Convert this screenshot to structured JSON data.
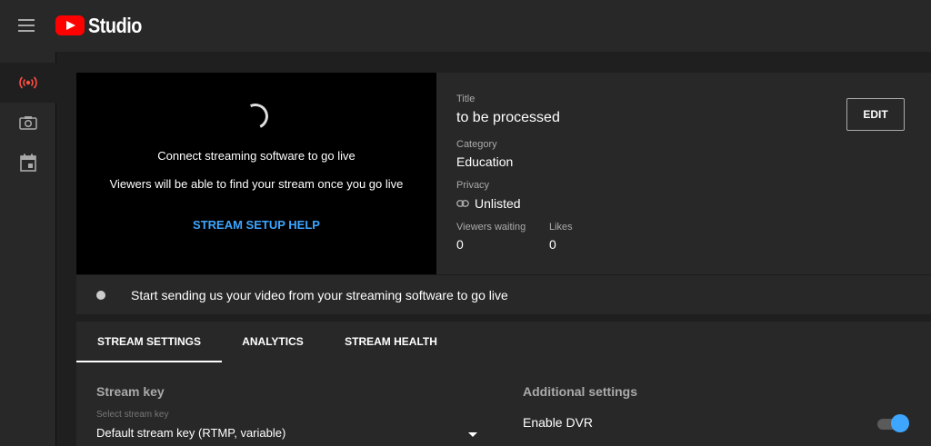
{
  "app": {
    "name": "Studio"
  },
  "colors": {
    "accent": "#3ea6ff",
    "brand": "#ff0000",
    "live_icon": "#ff4e45"
  },
  "sidebar": {
    "items": [
      {
        "icon": "live-icon",
        "active": true
      },
      {
        "icon": "camera-icon",
        "active": false
      },
      {
        "icon": "calendar-icon",
        "active": false
      }
    ]
  },
  "preview": {
    "line1": "Connect streaming software to go live",
    "line2": "Viewers will be able to find your stream once you go live",
    "help_link": "STREAM SETUP HELP"
  },
  "info": {
    "title_label": "Title",
    "title": "to be processed",
    "category_label": "Category",
    "category": "Education",
    "privacy_label": "Privacy",
    "privacy": "Unlisted",
    "viewers_label": "Viewers waiting",
    "viewers": "0",
    "likes_label": "Likes",
    "likes": "0",
    "edit_label": "EDIT"
  },
  "status": {
    "text": "Start sending us your video from your streaming software to go live"
  },
  "tabs": [
    {
      "label": "STREAM SETTINGS",
      "active": true
    },
    {
      "label": "ANALYTICS",
      "active": false
    },
    {
      "label": "STREAM HEALTH",
      "active": false
    }
  ],
  "settings": {
    "stream_key_heading": "Stream key",
    "select_label": "Select stream key",
    "select_value": "Default stream key (RTMP, variable)",
    "additional_heading": "Additional settings",
    "dvr_label": "Enable DVR",
    "dvr_enabled": true
  }
}
